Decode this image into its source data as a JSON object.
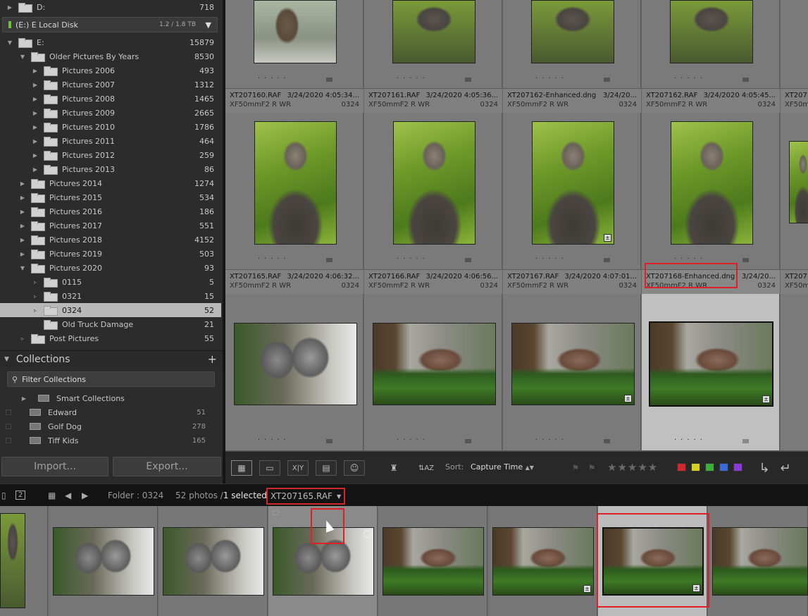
{
  "folders": {
    "top": [
      {
        "name": "D:",
        "count": "718"
      }
    ],
    "disk": {
      "label": "(E:) E Local Disk",
      "capacity": "1.2 / 1.8 TB"
    },
    "drive": {
      "name": "E:",
      "count": "15879"
    },
    "older": {
      "name": "Older Pictures By Years",
      "count": "8530"
    },
    "older_children": [
      {
        "name": "Pictures 2006",
        "count": "493"
      },
      {
        "name": "Pictures 2007",
        "count": "1312"
      },
      {
        "name": "Pictures 2008",
        "count": "1465"
      },
      {
        "name": "Pictures 2009",
        "count": "2665"
      },
      {
        "name": "Pictures 2010",
        "count": "1786"
      },
      {
        "name": "Pictures 2011",
        "count": "464"
      },
      {
        "name": "Pictures 2012",
        "count": "259"
      },
      {
        "name": "Pictures 2013",
        "count": "86"
      }
    ],
    "years": [
      {
        "name": "Pictures 2014",
        "count": "1274"
      },
      {
        "name": "Pictures 2015",
        "count": "534"
      },
      {
        "name": "Pictures 2016",
        "count": "186"
      },
      {
        "name": "Pictures 2017",
        "count": "551"
      },
      {
        "name": "Pictures 2018",
        "count": "4152"
      },
      {
        "name": "Pictures 2019",
        "count": "503"
      },
      {
        "name": "Pictures 2020",
        "count": "93"
      }
    ],
    "y2020_children": [
      {
        "name": "0115",
        "count": "5"
      },
      {
        "name": "0321",
        "count": "15"
      },
      {
        "name": "0324",
        "count": "52"
      },
      {
        "name": "Old Truck Damage",
        "count": "21"
      }
    ],
    "post": {
      "name": "Post Pictures",
      "count": "55"
    }
  },
  "collections": {
    "title": "Collections",
    "filter_placeholder": "Filter Collections",
    "smart": "Smart Collections",
    "items": [
      {
        "name": "Edward",
        "count": "51"
      },
      {
        "name": "Golf Dog",
        "count": "278"
      },
      {
        "name": "Tiff Kids",
        "count": "165"
      }
    ]
  },
  "buttons": {
    "import": "Import...",
    "export": "Export..."
  },
  "grid": {
    "row1": [
      {
        "file": "XT207160.RAF",
        "date": "3/24/2020 4:05:34...",
        "camera": "XF50mmF2 R WR",
        "num": "0324"
      },
      {
        "file": "XT207161.RAF",
        "date": "3/24/2020 4:05:36...",
        "camera": "XF50mmF2 R WR",
        "num": "0324"
      },
      {
        "file": "XT207162-Enhanced.dng",
        "date": "3/24/20...",
        "camera": "XF50mmF2 R WR",
        "num": "0324"
      },
      {
        "file": "XT207162.RAF",
        "date": "3/24/2020 4:05:45...",
        "camera": "XF50mmF2 R WR",
        "num": "0324"
      },
      {
        "file": "XT207",
        "date": "",
        "camera": "XF50mm",
        "num": ""
      }
    ],
    "row2": [
      {
        "file": "XT207165.RAF",
        "date": "3/24/2020 4:06:32...",
        "camera": "XF50mmF2 R WR",
        "num": "0324"
      },
      {
        "file": "XT207166.RAF",
        "date": "3/24/2020 4:06:56...",
        "camera": "XF50mmF2 R WR",
        "num": "0324"
      },
      {
        "file": "XT207167.RAF",
        "date": "3/24/2020 4:07:01...",
        "camera": "XF50mmF2 R WR",
        "num": "0324"
      },
      {
        "file": "XT207168-Enhanced.dng",
        "date": "3/24/20...",
        "camera": "XF50mmF2 R WR",
        "num": "0324"
      },
      {
        "file": "XT207",
        "date": "",
        "camera": "XF50mm",
        "num": ""
      }
    ]
  },
  "toolbar": {
    "sort_label": "Sort:",
    "sort_value": "Capture Time",
    "stars": "★★★★★"
  },
  "colors": {
    "red": "#d0282c",
    "yellow": "#d8d020",
    "green": "#3ab03a",
    "blue": "#3a6ad8",
    "purple": "#8a3ad8"
  },
  "filmstrip": {
    "page": "2",
    "folder": "Folder : 0324",
    "photos": "52 photos /",
    "selected": "1 selected",
    "filename": "XT207165.RAF"
  }
}
